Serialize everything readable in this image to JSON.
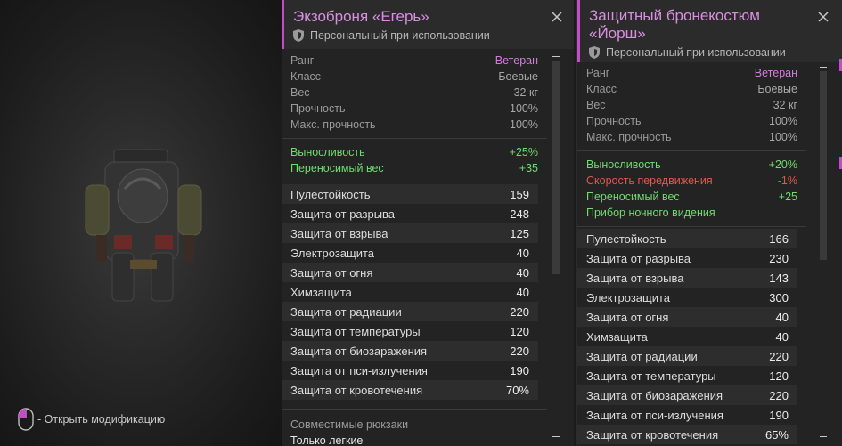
{
  "colors": {
    "accent": "#c54bc9",
    "title": "#d98fe0",
    "rank": "#cf7fd6",
    "positive": "#6fdc6f",
    "negative": "#e2574c"
  },
  "preview": {
    "hint": "- Открыть модификацию"
  },
  "card1": {
    "title": "Экзоброня «Егерь»",
    "personal": "Персональный при использовании",
    "info": [
      {
        "label": "Ранг",
        "value": "Ветеран"
      },
      {
        "label": "Класс",
        "value": "Боевые"
      },
      {
        "label": "Вес",
        "value": "32 кг"
      },
      {
        "label": "Прочность",
        "value": "100%"
      },
      {
        "label": "Макс. прочность",
        "value": "100%"
      }
    ],
    "bonuses": [
      {
        "label": "Выносливость",
        "value": "+25%"
      },
      {
        "label": "Переносимый вес",
        "value": "+35"
      }
    ],
    "protection": [
      {
        "label": "Пулестойкость",
        "value": "159"
      },
      {
        "label": "Защита от разрыва",
        "value": "248"
      },
      {
        "label": "Защита от взрыва",
        "value": "125"
      },
      {
        "label": "Электрозащита",
        "value": "40"
      },
      {
        "label": "Защита от огня",
        "value": "40"
      },
      {
        "label": "Химзащита",
        "value": "40"
      },
      {
        "label": "Защита от радиации",
        "value": "220"
      },
      {
        "label": "Защита от температуры",
        "value": "120"
      },
      {
        "label": "Защита от биозаражения",
        "value": "220"
      },
      {
        "label": "Защита от пси-излучения",
        "value": "190"
      },
      {
        "label": "Защита от кровотечения",
        "value": "70%"
      }
    ],
    "compat_label": "Совместимые рюкзаки",
    "compat_value": "Только легкие"
  },
  "card2": {
    "title_line1": "Защитный бронекостюм",
    "title_line2": "«Йорш»",
    "personal": "Персональный при использовании",
    "info": [
      {
        "label": "Ранг",
        "value": "Ветеран"
      },
      {
        "label": "Класс",
        "value": "Боевые"
      },
      {
        "label": "Вес",
        "value": "32 кг"
      },
      {
        "label": "Прочность",
        "value": "100%"
      },
      {
        "label": "Макс. прочность",
        "value": "100%"
      }
    ],
    "bonuses": [
      {
        "label": "Выносливость",
        "value": "+20%"
      },
      {
        "label": "Скорость передвижения",
        "value": "-1%"
      },
      {
        "label": "Переносимый вес",
        "value": "+25"
      },
      {
        "label": "Прибор ночного видения",
        "value": ""
      }
    ],
    "protection": [
      {
        "label": "Пулестойкость",
        "value": "166"
      },
      {
        "label": "Защита от разрыва",
        "value": "230"
      },
      {
        "label": "Защита от взрыва",
        "value": "143"
      },
      {
        "label": "Электрозащита",
        "value": "300"
      },
      {
        "label": "Защита от огня",
        "value": "40"
      },
      {
        "label": "Химзащита",
        "value": "40"
      },
      {
        "label": "Защита от радиации",
        "value": "220"
      },
      {
        "label": "Защита от температуры",
        "value": "120"
      },
      {
        "label": "Защита от биозаражения",
        "value": "220"
      },
      {
        "label": "Защита от пси-излучения",
        "value": "190"
      },
      {
        "label": "Защита от кровотечения",
        "value": "65%"
      }
    ]
  }
}
